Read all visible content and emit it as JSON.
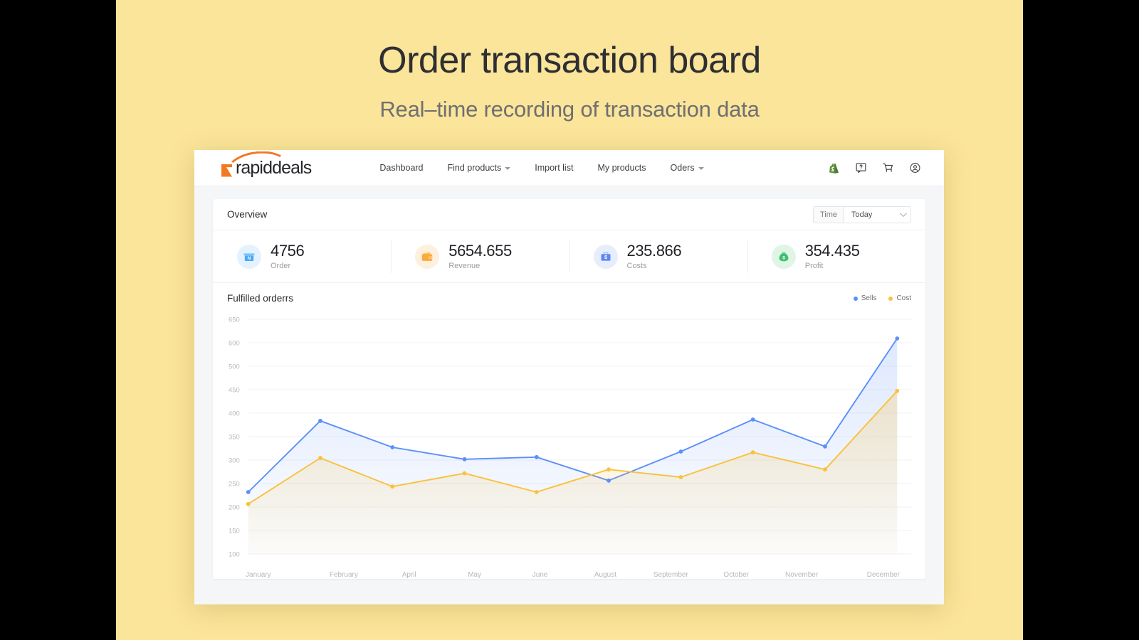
{
  "hero": {
    "title": "Order transaction board",
    "subtitle": "Real–time recording of transaction data",
    "background": "#fbe59a"
  },
  "navbar": {
    "brand": "rapiddeals",
    "brand_color": "#f47721",
    "links": [
      {
        "label": "Dashboard",
        "has_caret": false
      },
      {
        "label": "Find products",
        "has_caret": true
      },
      {
        "label": "Import list",
        "has_caret": false
      },
      {
        "label": "My products",
        "has_caret": false
      },
      {
        "label": "Oders",
        "has_caret": true
      }
    ],
    "icons": [
      {
        "name": "shopify-bag-icon",
        "color": "#5e8e3e"
      },
      {
        "name": "help-question-icon",
        "color": "#3c3d42"
      },
      {
        "name": "shopping-cart-icon",
        "color": "#3c3d42"
      },
      {
        "name": "account-circle-icon",
        "color": "#3c3d42"
      }
    ]
  },
  "overview": {
    "title": "Overview",
    "time_label": "Time",
    "time_value": "Today",
    "time_options": [
      "Today"
    ],
    "stats": [
      {
        "value": "4756",
        "label": "Order",
        "icon": "order-box-icon",
        "icon_bg": "#e3f2fe",
        "icon_color": "#49a8f5"
      },
      {
        "value": "5654.655",
        "label": "Revenue",
        "icon": "wallet-icon",
        "icon_bg": "#fdf0dd",
        "icon_color": "#f9ab3c"
      },
      {
        "value": "235.866",
        "label": "Costs",
        "icon": "costs-briefcase-icon",
        "icon_bg": "#e7edfd",
        "icon_color": "#5b86f5"
      },
      {
        "value": "354.435",
        "label": "Profit",
        "icon": "money-bag-icon",
        "icon_bg": "#dff5e6",
        "icon_color": "#3fbf6d"
      }
    ]
  },
  "chart_data": {
    "type": "line",
    "title": "Fulfilled orderrs",
    "xlabel": "",
    "ylabel": "",
    "grid": true,
    "legend_position": "top-right",
    "ylim": [
      100,
      650
    ],
    "yticks": [
      650,
      600,
      500,
      450,
      400,
      350,
      300,
      250,
      200,
      150,
      100
    ],
    "categories": [
      "January",
      "February",
      "April",
      "May",
      "June",
      "August",
      "September",
      "October",
      "November",
      "December"
    ],
    "series": [
      {
        "name": "Sells",
        "color": "#5b8ff9",
        "values": [
          245,
          412,
          350,
          322,
          327,
          272,
          340,
          415,
          352,
          605
        ]
      },
      {
        "name": "Cost",
        "color": "#fac13c",
        "values": [
          217,
          325,
          258,
          289,
          245,
          298,
          280,
          338,
          298,
          482
        ]
      }
    ]
  }
}
